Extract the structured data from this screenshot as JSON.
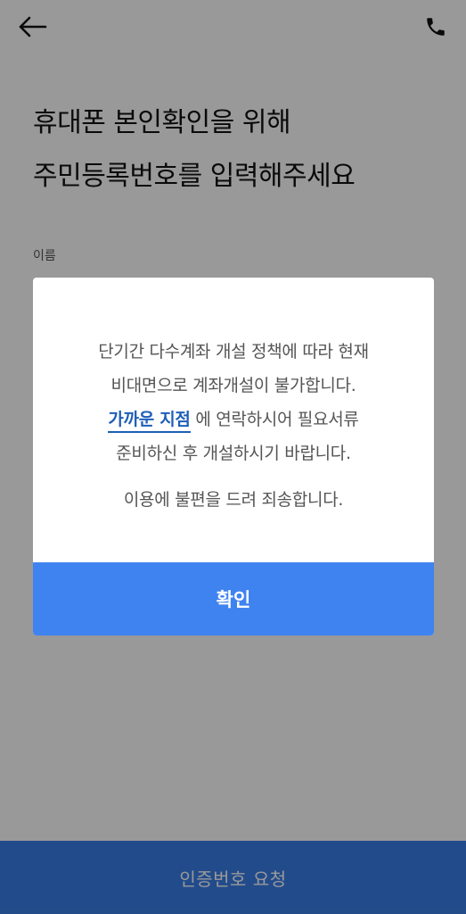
{
  "header": {
    "back_icon": "arrow-left-icon",
    "phone_icon": "phone-icon"
  },
  "headline": {
    "line1": "휴대폰 본인확인을 위해",
    "line2": "주민등록번호를 입력해주세요"
  },
  "form": {
    "name_label": "이름"
  },
  "bottom_button": {
    "label": "인증번호 요청"
  },
  "dialog": {
    "line1": "단기간 다수계좌 개설 정책에 따라 현재",
    "line2": "비대면으로 계좌개설이 불가합니다.",
    "link": "가까운 지점",
    "line3_rest": " 에 연락하시어 필요서류",
    "line4": "준비하신 후 개설하시기 바랍니다.",
    "apology": "이용에 불편을 드려 죄송합니다.",
    "confirm_label": "확인"
  },
  "colors": {
    "accent": "#3f83f0",
    "link": "#1f5fb7",
    "overlay": "rgba(0,0,0,0.40)"
  }
}
